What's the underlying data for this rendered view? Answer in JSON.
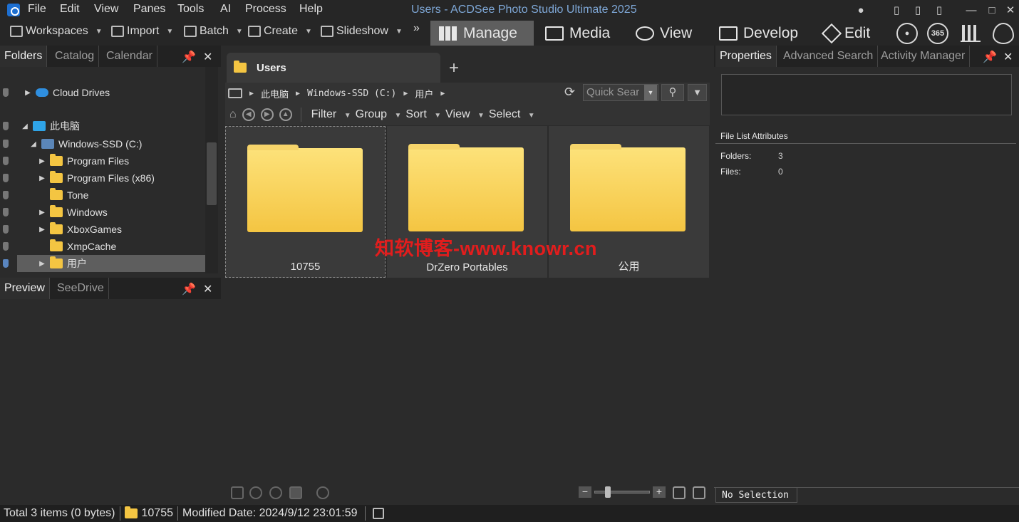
{
  "window": {
    "title": "Users - ACDSee Photo Studio Ultimate 2025"
  },
  "menu": [
    "File",
    "Edit",
    "View",
    "Panes",
    "Tools",
    "AI",
    "Process",
    "Help"
  ],
  "toolbar": {
    "workspaces": "Workspaces",
    "import": "Import",
    "batch": "Batch",
    "create": "Create",
    "slideshow": "Slideshow",
    "more": "»"
  },
  "modes": {
    "manage": "Manage",
    "media": "Media",
    "view": "View",
    "develop": "Develop",
    "edit": "Edit",
    "badge_365": "365",
    "active": "Manage"
  },
  "left_tabs": [
    "Folders",
    "Catalog",
    "Calendar"
  ],
  "bottom_left_tabs": [
    "Preview",
    "SeeDrive"
  ],
  "tree": {
    "cloud": "Cloud Drives",
    "pc": "此电脑",
    "drive": "Windows-SSD (C:)",
    "items": [
      "Program Files",
      "Program Files (x86)",
      "Tone",
      "Windows",
      "XboxGames",
      "XmpCache",
      "用户"
    ]
  },
  "document_tab": {
    "label": "Users",
    "add": "+"
  },
  "address": {
    "crumbs": [
      "此电脑",
      "Windows-SSD (C:)",
      "用户"
    ],
    "quick_search": "Quick Sear"
  },
  "nav": {
    "filter": "Filter",
    "group": "Group",
    "sort": "Sort",
    "view": "View",
    "select": "Select"
  },
  "files": [
    {
      "name": "10755"
    },
    {
      "name": "DrZero Portables"
    },
    {
      "name": "公用"
    }
  ],
  "watermark": "知软博客-www.knowr.cn",
  "right_tabs": [
    "Properties",
    "Advanced Search",
    "Activity Manager"
  ],
  "properties": {
    "header": "File List Attributes",
    "folders_label": "Folders:",
    "folders_value": "3",
    "files_label": "Files:",
    "files_value": "0",
    "selection": "No Selection"
  },
  "status": {
    "total": "Total 3 items  (0 bytes)",
    "folder": "10755",
    "modified": "Modified Date: 2024/9/12 23:01:59"
  },
  "colors": {
    "accent": "#7ea7d6",
    "folder": "#f4c542",
    "active_mode": "#5e5e5e"
  }
}
